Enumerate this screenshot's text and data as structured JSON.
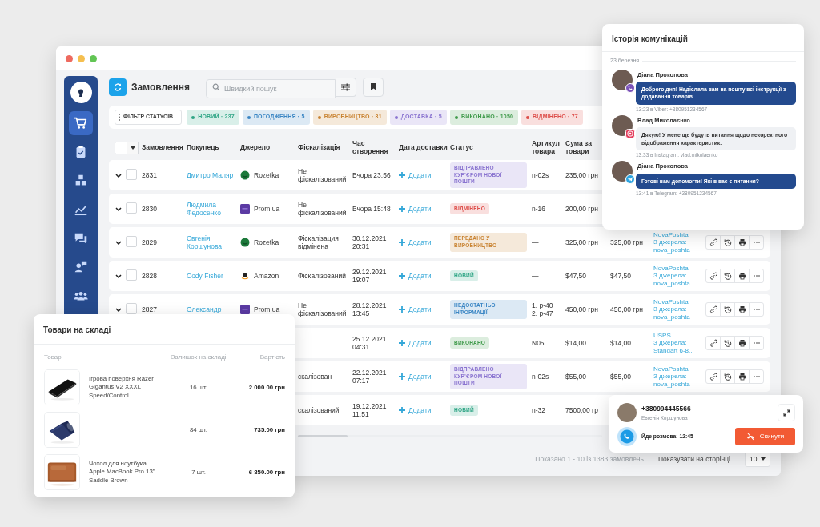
{
  "window": {
    "title": "Замовлення",
    "search": {
      "placeholder": "Швидкий пошук"
    }
  },
  "sidebar": {
    "items": [
      {
        "kind": "cart",
        "selected": true
      },
      {
        "kind": "clipboard",
        "selected": false
      },
      {
        "kind": "boxes",
        "selected": false
      },
      {
        "kind": "chart",
        "selected": false
      },
      {
        "kind": "chat",
        "selected": false
      },
      {
        "kind": "support",
        "selected": false
      },
      {
        "kind": "users",
        "selected": false
      }
    ]
  },
  "status_filter": {
    "label": "ФІЛЬТР СТАТУСІВ",
    "chips": [
      {
        "label": "НОВИЙ · 237",
        "color": "#2fa585"
      },
      {
        "label": "ПОГОДЖЕННЯ · 5",
        "color": "#3b86c4"
      },
      {
        "label": "ВИРОБНИЦТВО · 31",
        "color": "#c98433"
      },
      {
        "label": "ДОСТАВКА · 5",
        "color": "#8a74d0"
      },
      {
        "label": "ВИКОНАНО · 1050",
        "color": "#3f9a4a"
      },
      {
        "label": "ВІДМІНЕНО · 77",
        "color": "#dd4d49"
      }
    ]
  },
  "table": {
    "select_all": {
      "checked": false
    },
    "columns": [
      "Замовлення",
      "Покупець",
      "Джерело",
      "Фіскалізація",
      "Час створення",
      "Дата доставки",
      "Статус",
      "Артикул товара",
      "Сума за товари"
    ],
    "rows": [
      {
        "order": "2831",
        "checked": false,
        "customer": "Дмитро Маляр",
        "source": {
          "kind": "rozetka",
          "name": "Rozetka"
        },
        "fiscal": "Не фіскалізований",
        "created": "Вчора 23:56",
        "delivery": "Додати",
        "status": {
          "label": "ВІДПРАВЛЕНО КУР’ЄРОМ НОВОЇ ПОШТИ",
          "color": "#8a74d0"
        },
        "sku": [
          "n-02s"
        ],
        "sum": "235,00 грн"
      },
      {
        "order": "2830",
        "checked": false,
        "customer": "Людмила Федосенко",
        "source": {
          "kind": "prom",
          "name": "Prom.ua"
        },
        "fiscal": "Не фіскалізований",
        "created": "Вчора 15:48",
        "delivery": "Додати",
        "status": {
          "label": "ВІДМІНЕНО",
          "color": "#dd4d49"
        },
        "sku": [
          "n-16"
        ],
        "sum": "200,00 грн"
      },
      {
        "order": "2829",
        "checked": false,
        "customer": "Євгенія Коршунова",
        "source": {
          "kind": "rozetka",
          "name": "Rozetka"
        },
        "fiscal": "Фіскалізация відмінена",
        "created": "30.12.2021 20:31",
        "delivery": "Додати",
        "status": {
          "label": "ПЕРЕДАНО У ВИРОБНИЦТВО",
          "color": "#c98433"
        },
        "sku": [
          "—"
        ],
        "sum": "325,00 грн",
        "total": "325,00 грн",
        "shipping": {
          "carrier": "NovaPoshta",
          "source": "З джерела: nova_poshta"
        },
        "actions": true
      },
      {
        "order": "2828",
        "checked": false,
        "customer": "Cody Fisher",
        "source": {
          "kind": "amazon",
          "name": "Amazon"
        },
        "fiscal": "Фіскалізований",
        "created": "29.12.2021 19:07",
        "delivery": "Додати",
        "status": {
          "label": "НОВИЙ",
          "color": "#2fa585"
        },
        "sku": [
          "—"
        ],
        "sum": "$47,50",
        "total": "$47,50",
        "shipping": {
          "carrier": "NovaPoshta",
          "source": "З джерела: nova_poshta"
        },
        "actions": true
      },
      {
        "order": "2827",
        "checked": false,
        "customer": "Олександр",
        "source": {
          "kind": "prom",
          "name": "Prom.ua"
        },
        "fiscal": "Не фіскалізований",
        "created": "28.12.2021 13:45",
        "delivery": "Додати",
        "status": {
          "label": "НЕДОСТАТНЬО ІНФОРМАЦІЇ",
          "color": "#3b86c4"
        },
        "sku": [
          "1. p-40",
          "2. p-47"
        ],
        "sum": "450,00 грн",
        "total": "450,00 грн",
        "shipping": {
          "carrier": "NovaPoshta",
          "source": "З джерела: nova_poshta"
        },
        "actions": true
      },
      {
        "created": "25.12.2021 04:31",
        "delivery": "Додати",
        "status": {
          "label": "ВИКОНАНО",
          "color": "#3f9a4a"
        },
        "sku": [
          "N05"
        ],
        "sum": "$14,00",
        "total": "$14,00",
        "shipping": {
          "carrier": "USPS",
          "source": "З джерела: Standart 6-8..."
        },
        "actions": true
      },
      {
        "fiscal": "скалізован",
        "created": "22.12.2021 07:17",
        "delivery": "Додати",
        "status": {
          "label": "ВІДПРАВЛЕНО КУР’ЄРОМ НОВОЇ ПОШТИ",
          "color": "#8a74d0"
        },
        "sku": [
          "n-02s"
        ],
        "sum": "$55,00",
        "total": "$55,00",
        "shipping": {
          "carrier": "NovaPoshta",
          "source": "З джерела: nova_poshta"
        },
        "actions": true
      },
      {
        "fiscal": "скалізований",
        "created": "19.12.2021 11:51",
        "delivery": "Додати",
        "status": {
          "label": "НОВИЙ",
          "color": "#2fa585"
        },
        "sku": [
          "n-32"
        ],
        "sum": "7500,00 гр"
      }
    ]
  },
  "footer": {
    "summary": "Показано 1 - 10 із 1383 замовлень",
    "page_size_label": "Показувати на сторінці",
    "page_size": "10"
  },
  "chat": {
    "title": "Історія комунікацій",
    "date": "23 березня",
    "messages": [
      {
        "sender": "Діана Прокопова",
        "kind": "viber",
        "incoming": false,
        "text": "Доброго дня! Надіслала вам на пошту всі інструкції з додавання товарів.",
        "meta": "13:23 в Viber: +380951234567"
      },
      {
        "sender": "Влад Миколаєнко",
        "kind": "instagram",
        "incoming": true,
        "text": "Дякую! У мене ще будуть питання щодо некоректного відображення характеристик.",
        "meta": "13:33 в Instagram: vlad.mikolaenko"
      },
      {
        "sender": "Діана Прокопова",
        "kind": "telegram",
        "incoming": false,
        "text": "Готові вам допомогти! Які в вас є питання?",
        "meta": "13:41 в Telegram: +380951234567"
      }
    ]
  },
  "warehouse": {
    "title": "Товари на складі",
    "columns": [
      "Товар",
      "Залишок на складі",
      "Вартість"
    ],
    "items": [
      {
        "kind": "pad",
        "name": "Ігрова поверхня Razer Gigantus V2 XXXL Speed/Control",
        "stock": "16 шт.",
        "price": "2 000.00 грн"
      },
      {
        "kind": "mat",
        "stock": "84 шт.",
        "price": "735.00 грн"
      },
      {
        "kind": "sleeve",
        "name": "Чохол для ноутбука Apple MacBook Pro 13\" Saddle Brown",
        "stock": "7 шт.",
        "price": "6 850.00 грн"
      }
    ]
  },
  "call": {
    "phone": "+380994445566",
    "name": "Евгенія Коршунова",
    "status": "Йде розмова: 12:45",
    "button": "Скинути"
  }
}
